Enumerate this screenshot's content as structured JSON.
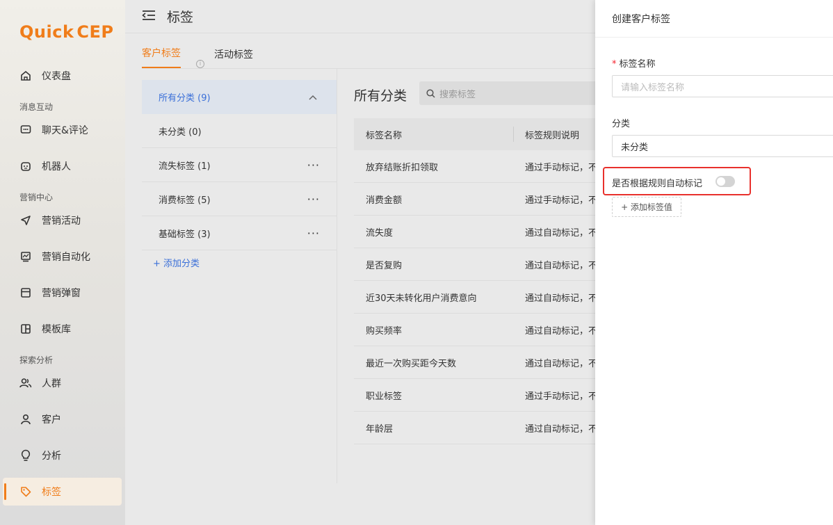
{
  "logo": {
    "q": "Q",
    "rest": "uick",
    "cep": "CEP"
  },
  "sidebar": {
    "items": [
      {
        "label": "仪表盘",
        "icon": "home-icon"
      },
      {
        "label": "聊天&评论",
        "icon": "chat-icon"
      },
      {
        "label": "机器人",
        "icon": "robot-icon"
      },
      {
        "label": "营销活动",
        "icon": "send-icon"
      },
      {
        "label": "营销自动化",
        "icon": "automation-icon"
      },
      {
        "label": "营销弹窗",
        "icon": "popup-icon"
      },
      {
        "label": "模板库",
        "icon": "template-icon"
      },
      {
        "label": "人群",
        "icon": "users-icon"
      },
      {
        "label": "客户",
        "icon": "user-icon"
      },
      {
        "label": "分析",
        "icon": "bulb-icon"
      },
      {
        "label": "标签",
        "icon": "tag-icon"
      }
    ],
    "groups": [
      "消息互动",
      "营销中心",
      "探索分析"
    ]
  },
  "header": {
    "title": "标签"
  },
  "tabs": [
    {
      "label": "客户标签",
      "active": true
    },
    {
      "label": "活动标签",
      "active": false
    }
  ],
  "categories": [
    {
      "label": "所有分类 (9)",
      "active": true
    },
    {
      "label": "未分类 (0)"
    },
    {
      "label": "流失标签 (1)"
    },
    {
      "label": "消费标签 (5)"
    },
    {
      "label": "基础标签 (3)"
    }
  ],
  "add_category": "+ 添加分类",
  "list": {
    "title": "所有分类",
    "search_placeholder": "搜索标签",
    "columns": [
      "标签名称",
      "标签规则说明"
    ],
    "rows": [
      [
        "放弃结账折扣领取",
        "通过手动标记，不"
      ],
      [
        "消费金额",
        "通过手动标记，不"
      ],
      [
        "流失度",
        "通过自动标记，不"
      ],
      [
        "是否复购",
        "通过自动标记，不"
      ],
      [
        "近30天未转化用户消费意向",
        "通过自动标记，不"
      ],
      [
        "购买频率",
        "通过自动标记，不"
      ],
      [
        "最近一次购买距今天数",
        "通过自动标记，不"
      ],
      [
        "职业标签",
        "通过手动标记，不"
      ],
      [
        "年龄层",
        "通过自动标记，不"
      ]
    ]
  },
  "drawer": {
    "title": "创建客户标签",
    "name_label": "标签名称",
    "required_mark": "*",
    "name_placeholder": "请输入标签名称",
    "category_label": "分类",
    "category_value": "未分类",
    "auto_label": "是否根据规则自动标记",
    "add_value": "+ 添加标签值"
  },
  "colors": {
    "accent": "#f07d1a",
    "link": "#3a6fd8",
    "highlight": "#e8302c"
  }
}
